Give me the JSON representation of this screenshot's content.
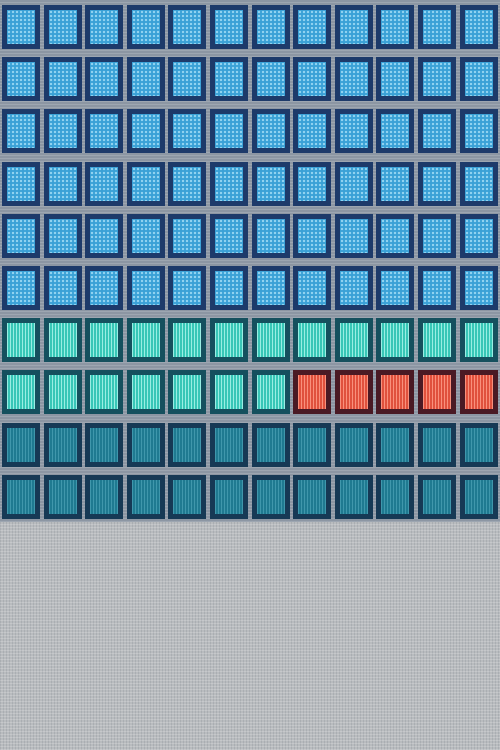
{
  "palette": {
    "blue": "#3aa1d6",
    "teal": "#38c6b7",
    "red": "#e0513d",
    "dark": "#1f7a91",
    "background": "#b9bcbf"
  },
  "grid": {
    "columns": 12,
    "rows": [
      [
        "blue",
        "blue",
        "blue",
        "blue",
        "blue",
        "blue",
        "blue",
        "blue",
        "blue",
        "blue",
        "blue",
        "blue"
      ],
      [
        "blue",
        "blue",
        "blue",
        "blue",
        "blue",
        "blue",
        "blue",
        "blue",
        "blue",
        "blue",
        "blue",
        "blue"
      ],
      [
        "blue",
        "blue",
        "blue",
        "blue",
        "blue",
        "blue",
        "blue",
        "blue",
        "blue",
        "blue",
        "blue",
        "blue"
      ],
      [
        "blue",
        "blue",
        "blue",
        "blue",
        "blue",
        "blue",
        "blue",
        "blue",
        "blue",
        "blue",
        "blue",
        "blue"
      ],
      [
        "blue",
        "blue",
        "blue",
        "blue",
        "blue",
        "blue",
        "blue",
        "blue",
        "blue",
        "blue",
        "blue",
        "blue"
      ],
      [
        "blue",
        "blue",
        "blue",
        "blue",
        "blue",
        "blue",
        "blue",
        "blue",
        "blue",
        "blue",
        "blue",
        "blue"
      ],
      [
        "teal",
        "teal",
        "teal",
        "teal",
        "teal",
        "teal",
        "teal",
        "teal",
        "teal",
        "teal",
        "teal",
        "teal"
      ],
      [
        "teal",
        "teal",
        "teal",
        "teal",
        "teal",
        "teal",
        "teal",
        "red",
        "red",
        "red",
        "red",
        "red"
      ],
      [
        "dark",
        "dark",
        "dark",
        "dark",
        "dark",
        "dark",
        "dark",
        "dark",
        "dark",
        "dark",
        "dark",
        "dark"
      ],
      [
        "dark",
        "dark",
        "dark",
        "dark",
        "dark",
        "dark",
        "dark",
        "dark",
        "dark",
        "dark",
        "dark",
        "dark"
      ]
    ]
  }
}
